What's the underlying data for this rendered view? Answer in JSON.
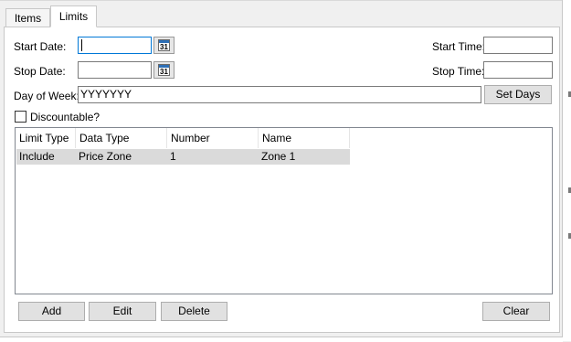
{
  "tabs": [
    {
      "label": "Items"
    },
    {
      "label": "Limits"
    }
  ],
  "form": {
    "start_date_label": "Start Date:",
    "start_date_value": "",
    "stop_date_label": "Stop Date:",
    "stop_date_value": "",
    "start_time_label": "Start Time:",
    "start_time_value": "",
    "stop_time_label": "Stop Time:",
    "stop_time_value": "",
    "calendar_glyph": "31",
    "day_of_week_label": "Day of Week:",
    "day_of_week_value": "YYYYYYY",
    "set_days_label": "Set Days",
    "discountable_label": "Discountable?",
    "discountable_checked": false
  },
  "grid": {
    "columns": [
      "Limit Type",
      "Data Type",
      "Number",
      "Name"
    ],
    "rows": [
      [
        "Include",
        "Price Zone",
        "1",
        "Zone 1"
      ]
    ]
  },
  "buttons": {
    "add": "Add",
    "edit": "Edit",
    "delete": "Delete",
    "clear": "Clear"
  },
  "icons": {
    "calendar": "calendar-icon",
    "checkbox": "checkbox"
  }
}
